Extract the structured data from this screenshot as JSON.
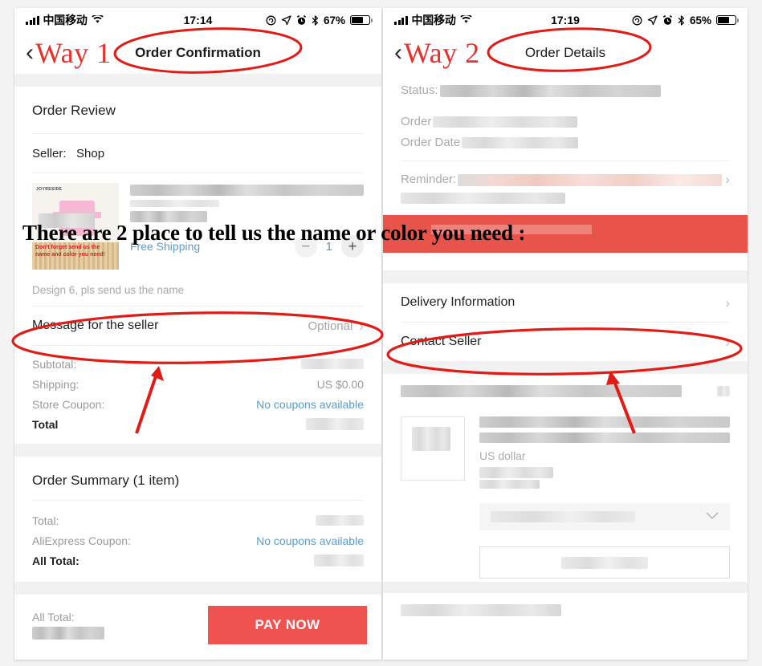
{
  "annotation": {
    "overlay_text": "There are 2 place to tell us the name or color you need :",
    "circle_color": "#e11b16",
    "arrow_color": "#e11b16"
  },
  "left_phone": {
    "status_bar": {
      "carrier": "中国移动",
      "time": "17:14",
      "battery_percent": "67%",
      "icons": [
        "signal-bars-icon",
        "wifi-icon",
        "rotation-lock-icon",
        "location-arrow-icon",
        "alarm-clock-icon",
        "bluetooth-icon",
        "battery-icon"
      ]
    },
    "nav": {
      "back_icon": "chevron-left-icon",
      "way_label": "Way 1",
      "title": "Order Confirmation"
    },
    "order_review": {
      "heading": "Order Review",
      "seller_label": "Seller:",
      "seller_name": "Shop"
    },
    "product": {
      "image_brand": "JOYRESIDE",
      "image_caption": "Don't forget send us the name and color you need!",
      "title_redacted": true,
      "shipping_label": "Free Shipping",
      "quantity": "1",
      "minus_icon": "minus-icon",
      "plus_icon": "plus-icon",
      "variant_note": "Design 6, pls send us the name"
    },
    "message_row": {
      "label": "Message for the seller",
      "value": "Optional",
      "chevron": "chevron-right-icon"
    },
    "totals": [
      {
        "label": "Subtotal:",
        "value": "",
        "redacted": true,
        "link": false
      },
      {
        "label": "Shipping:",
        "value": "US $0.00",
        "redacted": false,
        "link": false
      },
      {
        "label": "Store Coupon:",
        "value": "No coupons available",
        "redacted": false,
        "link": true
      },
      {
        "label": "Total",
        "value": "",
        "redacted": true,
        "link": false,
        "bold": true
      }
    ],
    "order_summary": {
      "heading": "Order Summary (1 item)",
      "rows": [
        {
          "label": "Total:",
          "value": "",
          "redacted": true,
          "link": false
        },
        {
          "label": "AliExpress Coupon:",
          "value": "No coupons available",
          "redacted": false,
          "link": true
        },
        {
          "label": "All Total:",
          "value": "",
          "redacted": true,
          "link": false,
          "bold": true
        }
      ]
    },
    "pay_bar": {
      "all_total_label": "All Total:",
      "all_total_value_redacted": true,
      "pay_button": "PAY NOW",
      "pay_button_color": "#ef5350"
    }
  },
  "right_phone": {
    "status_bar": {
      "carrier": "中国移动",
      "time": "17:19",
      "battery_percent": "65%",
      "icons": [
        "signal-bars-icon",
        "wifi-icon",
        "rotation-lock-icon",
        "location-arrow-icon",
        "alarm-clock-icon",
        "bluetooth-icon",
        "battery-icon"
      ]
    },
    "nav": {
      "back_icon": "chevron-left-icon",
      "way_label": "Way 2",
      "title": "Order Details"
    },
    "details": [
      {
        "label": "Status:",
        "value_redacted": true
      },
      {
        "label": "Order",
        "value_redacted": true
      },
      {
        "label": "Order Date",
        "value_redacted": true
      }
    ],
    "reminder": {
      "label": "Reminder:",
      "value_redacted": true
    },
    "banner": {
      "color": "#e8544a",
      "text_redacted": true
    },
    "action_rows": [
      {
        "label": "Delivery Information",
        "chevron": "chevron-right-icon"
      },
      {
        "label": "Contact Seller",
        "chevron": "chevron-right-icon"
      }
    ],
    "item": {
      "price_unit": "US dollar",
      "title_redacted": true,
      "select_chevron": "chevron-down-icon",
      "select_value_redacted": true,
      "button_label_redacted": true
    }
  }
}
